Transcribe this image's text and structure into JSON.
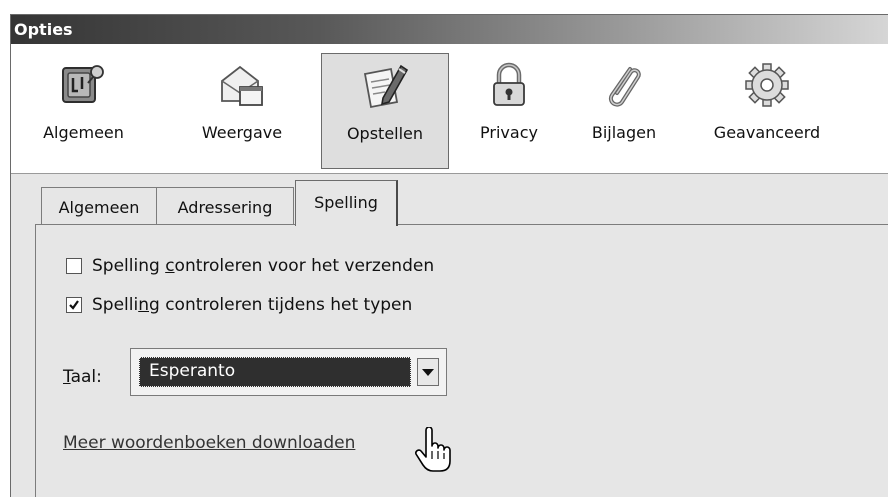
{
  "window": {
    "title": "Opties"
  },
  "toolbar": {
    "items": [
      {
        "label": "Algemeen",
        "icon": "general-switch-icon",
        "selected": false
      },
      {
        "label": "Weergave",
        "icon": "display-window-icon",
        "selected": false
      },
      {
        "label": "Opstellen",
        "icon": "compose-pen-icon",
        "selected": true
      },
      {
        "label": "Privacy",
        "icon": "padlock-icon",
        "selected": false
      },
      {
        "label": "Bijlagen",
        "icon": "paperclip-icon",
        "selected": false
      },
      {
        "label": "Geavanceerd",
        "icon": "gear-icon",
        "selected": false
      }
    ]
  },
  "tabs": [
    {
      "label": "Algemeen",
      "selected": false
    },
    {
      "label": "Adressering",
      "selected": false
    },
    {
      "label": "Spelling",
      "selected": true
    }
  ],
  "spelling": {
    "check_before_send": {
      "label_pre": "Spelling ",
      "label_accel": "c",
      "label_post": "ontroleren voor het verzenden",
      "checked": false
    },
    "check_while_typing": {
      "label_pre": "Spelli",
      "label_accel": "n",
      "label_post": "g controleren tijdens het typen",
      "checked": true
    },
    "language": {
      "label_accel": "T",
      "label_rest": "aal:",
      "selected_value": "Esperanto"
    },
    "download_link": "Meer woordenboeken downloaden"
  },
  "colors": {
    "window_bg": "#e6e6e6",
    "titlebar_text": "#ffffff",
    "select_highlight": "#2f2f2f"
  }
}
